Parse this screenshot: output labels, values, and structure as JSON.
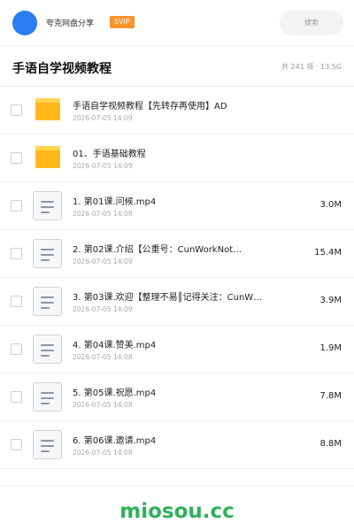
{
  "header": {
    "site_name": "夸克网盘分享",
    "badge": "SVIP",
    "search_placeholder": "搜索"
  },
  "page": {
    "title": "手语自学视频教程",
    "stats": "共 241 项 · 13.5G"
  },
  "files": [
    {
      "type": "folder",
      "icon": "folder-icon",
      "name": "手语自学视频教程【先转存再使用】AD",
      "date": "2026-07-05 14:09",
      "size": ""
    },
    {
      "type": "folder",
      "icon": "folder-icon",
      "name": "01、手语基础教程",
      "date": "2026-07-05 14:09",
      "size": ""
    },
    {
      "type": "file",
      "icon": "document-icon",
      "name": "1. 第01课.问候.mp4",
      "date": "2026-07-05 14:08",
      "size": "3.0M"
    },
    {
      "type": "file",
      "icon": "document-icon",
      "name": "2. 第02课.介绍【公重号：CunWorkNot…",
      "date": "2026-07-05 14:09",
      "size": "15.4M"
    },
    {
      "type": "file",
      "icon": "document-icon",
      "name": "3. 第03课.欢迎【整理不易║记得关注：CunW…",
      "date": "2026-07-05 14:09",
      "size": "3.9M"
    },
    {
      "type": "file",
      "icon": "document-icon",
      "name": "4. 第04课.赞美.mp4",
      "date": "2026-07-05 14:08",
      "size": "1.9M"
    },
    {
      "type": "file",
      "icon": "document-icon",
      "name": "5. 第05课.祝愿.mp4",
      "date": "2026-07-05 14:08",
      "size": "7.8M"
    },
    {
      "type": "file",
      "icon": "document-icon",
      "name": "6. 第06课.邀请.mp4",
      "date": "2026-07-05 14:08",
      "size": "8.8M"
    }
  ],
  "footer": {
    "brand": "miosou.cc"
  },
  "colors": {
    "accent_blue": "#2b7bf3",
    "svip_orange": "#f8942b",
    "folder_yellow": "#ffb81a",
    "brand_green": "#2fb05a"
  }
}
